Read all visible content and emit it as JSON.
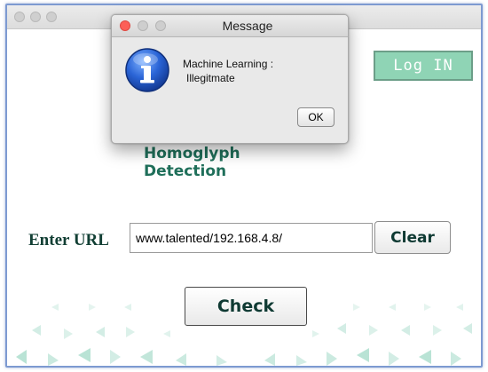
{
  "app": {
    "title": "Homoglyph Detection",
    "login_label": "Log IN",
    "url_label": "Enter URL",
    "url_value": "www.talented/192.168.4.8/",
    "clear_label": "Clear",
    "check_label": "Check"
  },
  "dialog": {
    "title": "Message",
    "icon": "info-icon",
    "message_line1": "Machine Learning :",
    "message_line2": "Illegitmate",
    "ok_label": "OK"
  },
  "colors": {
    "accent": "#8fd4b5",
    "title_text": "#1f6f5a",
    "label_text": "#123f34",
    "close_red": "#fc5f57",
    "info_blue": "#1f58c9",
    "pattern": "#9fd6c5"
  }
}
